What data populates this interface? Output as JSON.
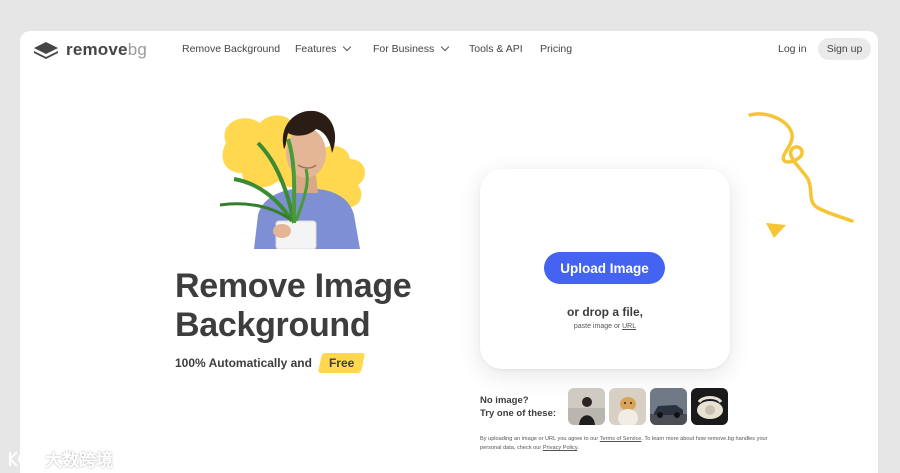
{
  "brand": {
    "name_part1": "remove",
    "name_part2": "bg"
  },
  "nav": {
    "links": [
      {
        "label": "Remove Background"
      },
      {
        "label": "Features"
      },
      {
        "label": "For Business"
      },
      {
        "label": "Tools & API"
      },
      {
        "label": "Pricing"
      }
    ],
    "login": "Log in",
    "signup": "Sign up"
  },
  "hero": {
    "headline_line1": "Remove Image",
    "headline_line2": "Background",
    "tagline": "100% Automatically and",
    "badge": "Free"
  },
  "upload": {
    "button": "Upload Image",
    "drop": "or drop a file,",
    "paste_prefix": "paste image or",
    "paste_link": "URL"
  },
  "samples": {
    "line1": "No image?",
    "line2": "Try one of these:"
  },
  "legal": {
    "part1": "By uploading an image or URL you agree to our",
    "terms": "Terms of Service",
    "part2": ". To learn more about how remove.bg handles your personal data, check our",
    "privacy": "Privacy Policy",
    "part3": "."
  },
  "watermark": {
    "text": "大数跨境"
  },
  "colors": {
    "accent": "#4363f0",
    "yellow": "#ffd84f",
    "text": "#3d3d3d"
  },
  "icons": [
    "layers-logo-icon",
    "chevron-down-icon",
    "person-plant-illustration",
    "squiggle-decoration",
    "triangle-decoration"
  ]
}
